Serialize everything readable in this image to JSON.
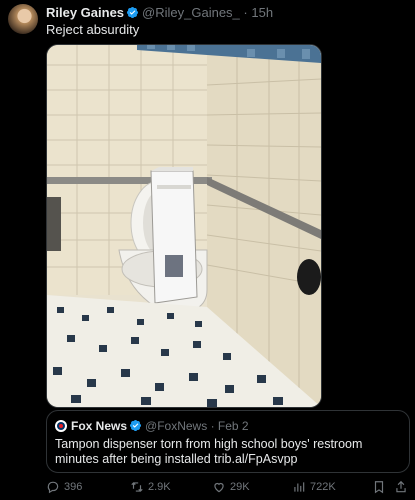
{
  "tweet": {
    "author_name": "Riley Gaines",
    "author_handle": "@Riley_Gaines_",
    "separator": "·",
    "time": "15h",
    "text": "Reject absurdity"
  },
  "quote": {
    "author_name": "Fox News",
    "author_handle": "@FoxNews",
    "separator": "·",
    "date": "Feb 2",
    "text": "Tampon dispenser torn from high school boys' restroom minutes after being installed trib.al/FpAsvpp"
  },
  "actions": {
    "replies": "396",
    "reposts": "2.9K",
    "likes": "29K",
    "views": "722K"
  },
  "colors": {
    "background": "#000000",
    "text": "#e7e9ea",
    "muted": "#71767b",
    "verified": "#1d9bf0",
    "border": "#2f3336"
  },
  "icons": [
    "verified-badge-icon",
    "reply-icon",
    "repost-icon",
    "like-icon",
    "views-icon",
    "bookmark-icon",
    "share-icon"
  ]
}
